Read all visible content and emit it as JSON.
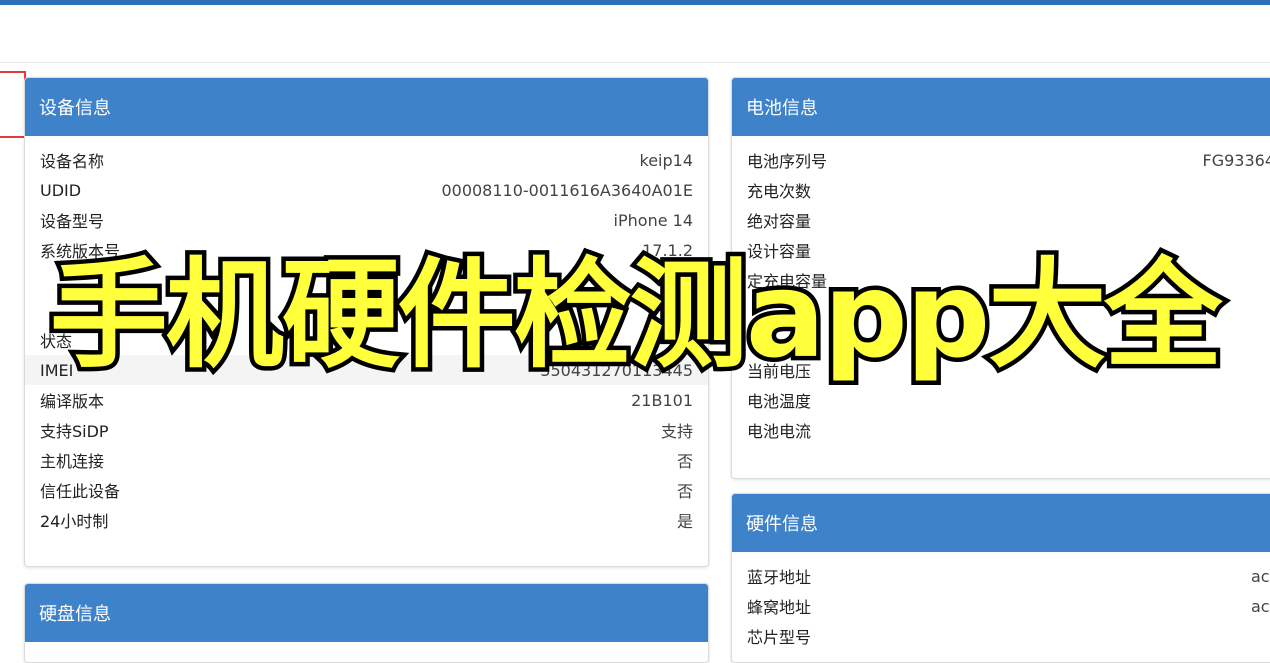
{
  "colors": {
    "accent": "#3e82c9",
    "overlay_text": "#ffff3b",
    "marker": "#e23b3b"
  },
  "device_panel": {
    "title": "设备信息",
    "rows": [
      {
        "label": "设备名称",
        "value": "keip14"
      },
      {
        "label": "UDID",
        "value": "00008110-0011616A3640A01E"
      },
      {
        "label": "设备型号",
        "value": "iPhone 14"
      },
      {
        "label": "系统版本号",
        "value": "17.1.2"
      },
      {
        "label": "",
        "value": ""
      },
      {
        "label": "",
        "value": ""
      },
      {
        "label": "状态",
        "value": ""
      },
      {
        "label": "IMEI",
        "value": "350431270113445"
      },
      {
        "label": "编译版本",
        "value": "21B101"
      },
      {
        "label": "支持SiDP",
        "value": "支持"
      },
      {
        "label": "主机连接",
        "value": "否"
      },
      {
        "label": "信任此设备",
        "value": "否"
      },
      {
        "label": "24小时制",
        "value": "是"
      }
    ]
  },
  "disk_panel": {
    "title": "硬盘信息"
  },
  "battery_panel": {
    "title": "电池信息",
    "rows": [
      {
        "label": "电池序列号",
        "value": "FG93364"
      },
      {
        "label": "充电次数",
        "value": ""
      },
      {
        "label": "绝对容量",
        "value": ""
      },
      {
        "label": "设计容量",
        "value": ""
      },
      {
        "label": "定充电容量",
        "value": ""
      },
      {
        "label": "",
        "value": ""
      },
      {
        "label": "",
        "value": ""
      },
      {
        "label": "当前电压",
        "value": ""
      },
      {
        "label": "电池温度",
        "value": ""
      },
      {
        "label": "电池电流",
        "value": ""
      }
    ]
  },
  "hardware_panel": {
    "title": "硬件信息",
    "rows": [
      {
        "label": "蓝牙地址",
        "value": "ac:"
      },
      {
        "label": "蜂窝地址",
        "value": "ac:"
      },
      {
        "label": "芯片型号",
        "value": ""
      }
    ]
  },
  "overlay": {
    "title": "手机硬件检测app大全"
  }
}
